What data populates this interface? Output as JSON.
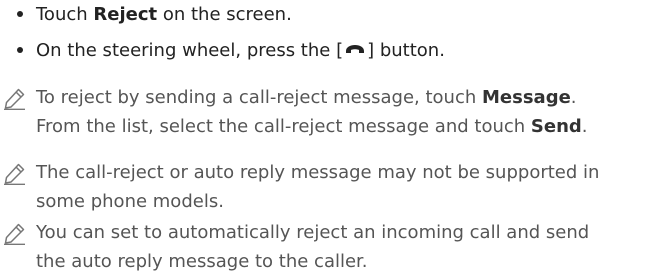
{
  "bullets": [
    {
      "pre": "Touch ",
      "bold": "Reject",
      "post": " on the screen."
    },
    {
      "pre": "On the steering wheel, press the [",
      "icon": "call-end-icon",
      "post": "] button."
    }
  ],
  "notes": [
    {
      "icon": "pencil-note-icon",
      "line1_pre": "To reject by sending a call-reject message, touch ",
      "line1_bold": "Message",
      "line1_post": ".",
      "line2_pre": "From the list, select the call-reject message and touch ",
      "line2_bold": "Send",
      "line2_post": "."
    },
    {
      "icon": "pencil-note-icon",
      "line1": "The call-reject or auto reply message may not be supported in",
      "line2": "some phone models."
    },
    {
      "icon": "pencil-note-icon",
      "line1": "You can set to automatically reject an incoming call and send",
      "line2": "the auto reply message to the caller."
    }
  ]
}
